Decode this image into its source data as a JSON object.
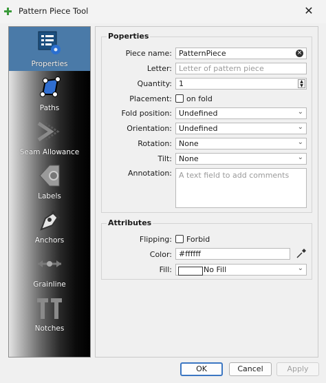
{
  "window": {
    "title": "Pattern Piece Tool"
  },
  "sidebar": {
    "items": [
      {
        "label": "Properties",
        "icon": "properties-icon",
        "active": true
      },
      {
        "label": "Paths",
        "icon": "paths-icon"
      },
      {
        "label": "Seam Allowance",
        "icon": "seam-allowance-icon"
      },
      {
        "label": "Labels",
        "icon": "labels-icon"
      },
      {
        "label": "Anchors",
        "icon": "anchors-icon"
      },
      {
        "label": "Grainline",
        "icon": "grainline-icon"
      },
      {
        "label": "Notches",
        "icon": "notches-icon"
      }
    ]
  },
  "properties": {
    "title": "Poperties",
    "piece_name_label": "Piece name:",
    "piece_name_value": "PatternPiece",
    "letter_label": "Letter:",
    "letter_placeholder": "Letter of pattern piece",
    "quantity_label": "Quantity:",
    "quantity_value": "1",
    "placement_label": "Placement:",
    "placement_checkbox": "on fold",
    "fold_position_label": "Fold position:",
    "fold_position_value": "Undefined",
    "orientation_label": "Orientation:",
    "orientation_value": "Undefined",
    "rotation_label": "Rotation:",
    "rotation_value": "None",
    "tilt_label": "Tilt:",
    "tilt_value": "None",
    "annotation_label": "Annotation:",
    "annotation_placeholder": "A text field to add comments"
  },
  "attributes": {
    "title": "Attributes",
    "flipping_label": "Flipping:",
    "flipping_checkbox": "Forbid",
    "color_label": "Color:",
    "color_value": "#ffffff",
    "fill_label": "Fill:",
    "fill_value": "No Fill"
  },
  "buttons": {
    "ok": "OK",
    "cancel": "Cancel",
    "apply": "Apply"
  },
  "colors": {
    "active_nav": "#4a7aa8",
    "primary_border": "#3b76c2"
  }
}
